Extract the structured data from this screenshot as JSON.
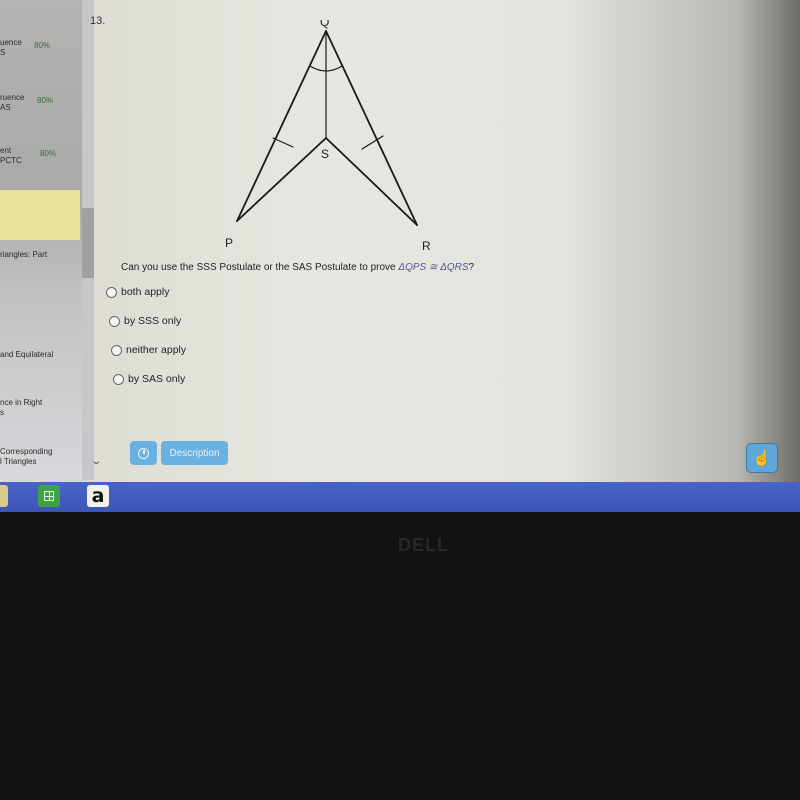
{
  "sidebar": {
    "items": [
      {
        "line1": "uence",
        "line2": "S",
        "pct": "80%"
      },
      {
        "line1": "ruence",
        "line2": "AS",
        "pct": "80%"
      },
      {
        "line1": "ent",
        "line2": "PCTC",
        "pct": "80%"
      },
      {
        "line1": "riangles: Part",
        "line2": ""
      },
      {
        "line1": "and Equilateral",
        "line2": ""
      },
      {
        "line1": "nce in Right",
        "line2": "s"
      },
      {
        "line1": "Corresponding",
        "line2": "l Triangles"
      }
    ]
  },
  "question": {
    "number": "13.",
    "text": "Can you use the SSS Postulate or the SAS Postulate to prove ",
    "math": "ΔQPS ≅ ΔQRS",
    "end": "?",
    "options": [
      {
        "label": "both apply",
        "selected": false
      },
      {
        "label": "by SSS only",
        "selected": false
      },
      {
        "label": "neither apply",
        "selected": false
      },
      {
        "label": "by SAS only",
        "selected": false
      }
    ]
  },
  "diagram": {
    "labels": {
      "Q": "Q",
      "S": "S",
      "P": "P",
      "R": "R"
    }
  },
  "buttons": {
    "description_label": "Description",
    "hand_icon": "☝"
  },
  "taskbar": {
    "amazon_label": "a"
  },
  "bezel": {
    "brand": "DELL"
  }
}
